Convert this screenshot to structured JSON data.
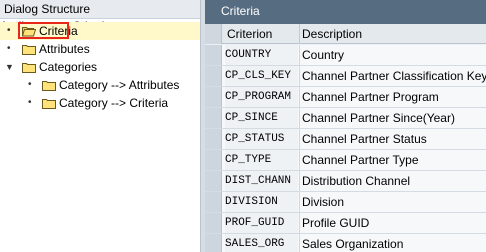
{
  "left_panel": {
    "header": "Dialog Structure",
    "tree": [
      {
        "label": "Criteria",
        "selected": true
      },
      {
        "label": "Attributes",
        "selected": false
      },
      {
        "label": "Categories",
        "selected": false,
        "expanded": true
      },
      {
        "label": "Category --> Attributes",
        "selected": false
      },
      {
        "label": "Category --> Criteria",
        "selected": false
      }
    ]
  },
  "right_panel": {
    "title": "Criteria",
    "columns": [
      "Criterion",
      "Description"
    ],
    "rows": [
      {
        "criterion": "COUNTRY",
        "description": "Country"
      },
      {
        "criterion": "CP_CLS_KEY",
        "description": "Channel Partner Classification Key"
      },
      {
        "criterion": "CP_PROGRAM",
        "description": "Channel Partner Program"
      },
      {
        "criterion": "CP_SINCE",
        "description": "Channel Partner Since(Year)"
      },
      {
        "criterion": "CP_STATUS",
        "description": "Channel Partner Status"
      },
      {
        "criterion": "CP_TYPE",
        "description": "Channel Partner Type"
      },
      {
        "criterion": "DIST_CHANN",
        "description": "Distribution Channel"
      },
      {
        "criterion": "DIVISION",
        "description": "Division"
      },
      {
        "criterion": "PROF_GUID",
        "description": "Profile GUID"
      },
      {
        "criterion": "SALES_ORG",
        "description": "Sales Organization"
      }
    ]
  },
  "colors": {
    "title_bar": "#566c80",
    "selection": "#fff8c8",
    "highlight_box": "#e8261c"
  }
}
